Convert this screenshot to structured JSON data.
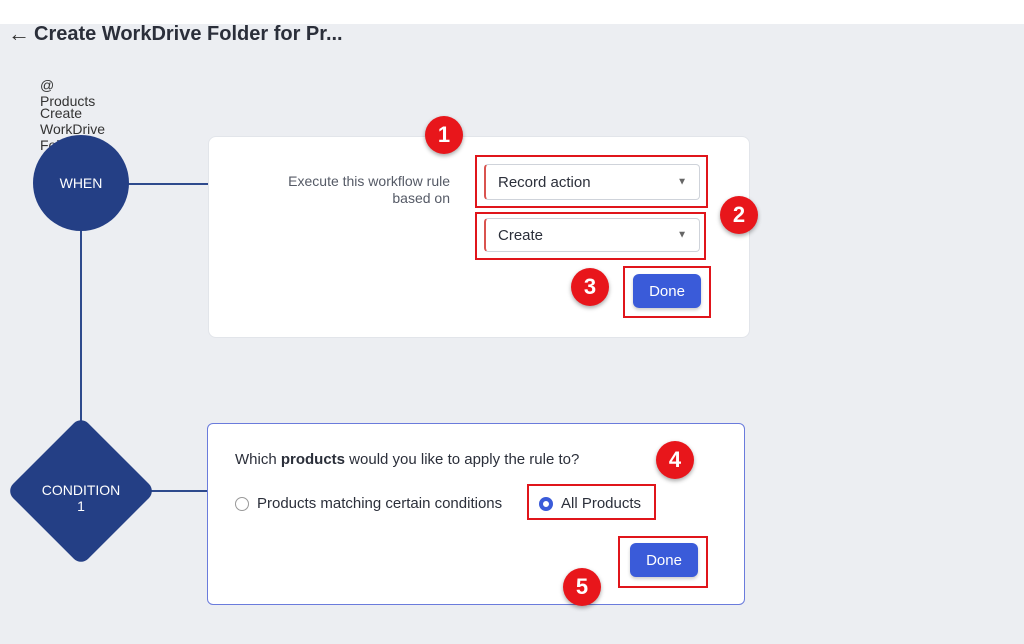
{
  "header": {
    "title": "Create WorkDrive Folder for Pr...",
    "module": "@ Products",
    "description": "Create WorkDrive Folder for Product"
  },
  "nodes": {
    "when": "WHEN",
    "condition": "CONDITION\n1"
  },
  "when_card": {
    "label": "Execute this workflow rule based on",
    "select1": "Record action",
    "select2": "Create",
    "done": "Done"
  },
  "condition_card": {
    "question_pre": "Which ",
    "question_bold": "products",
    "question_post": " would you like to apply the rule to?",
    "option1": "Products matching certain conditions",
    "option2": "All Products",
    "selected": "All Products",
    "done": "Done"
  },
  "badges": [
    "1",
    "2",
    "3",
    "4",
    "5"
  ],
  "colors": {
    "node": "#243f85",
    "button": "#3a5bd9",
    "highlight": "#e0151b",
    "badge": "#e8161b"
  }
}
